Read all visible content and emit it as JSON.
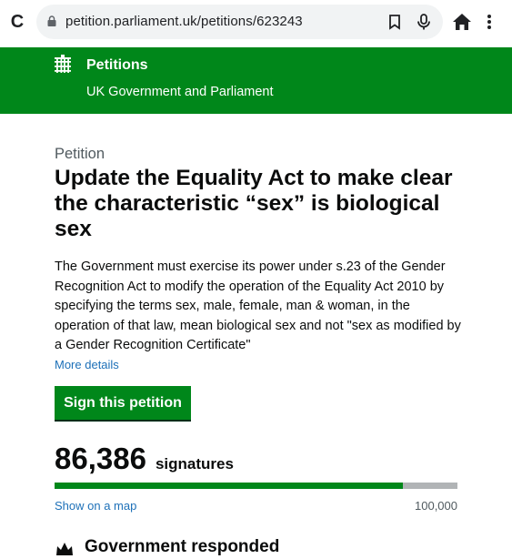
{
  "browser": {
    "url": "petition.parliament.uk/petitions/623243"
  },
  "header": {
    "site_name": "Petitions",
    "subtitle": "UK Government and Parliament"
  },
  "petition": {
    "caption": "Petition",
    "title": "Update the Equality Act to make clear the characteristic “sex” is biological sex",
    "summary": "The Government must exercise its power under s.23 of the Gender Recognition Act to modify the operation of the Equality Act 2010 by specifying the terms sex, male, female, man & woman, in the operation of that law, mean biological sex and not \"sex as modified by a Gender Recognition Certificate\"",
    "more_details": "More details",
    "sign_button": "Sign this petition",
    "signature_count": "86,386",
    "signature_label": "signatures",
    "progress_fraction": 0.86386,
    "map_link": "Show on a map",
    "threshold": "100,000",
    "response_heading": "Government responded"
  },
  "colors": {
    "brand_green": "#00871a",
    "link_blue": "#1d70b8",
    "progress_track": "#b1b4b6"
  }
}
